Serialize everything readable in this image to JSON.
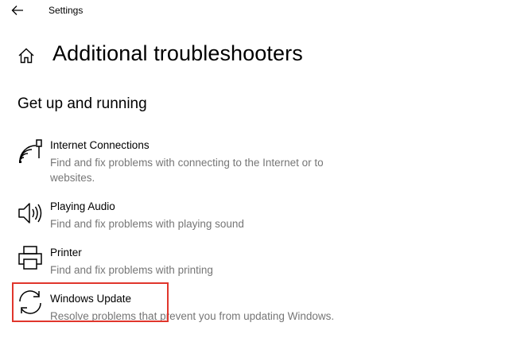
{
  "window": {
    "app_title": "Settings",
    "back_icon": "back-arrow-icon",
    "home_icon": "home-icon"
  },
  "page": {
    "title": "Additional troubleshooters"
  },
  "section": {
    "title": "Get up and running",
    "items": [
      {
        "icon": "internet-connections-icon",
        "name": "Internet Connections",
        "description": "Find and fix problems with connecting to the Internet or to websites."
      },
      {
        "icon": "speaker-icon",
        "name": "Playing Audio",
        "description": "Find and fix problems with playing sound"
      },
      {
        "icon": "printer-icon",
        "name": "Printer",
        "description": "Find and fix problems with printing"
      },
      {
        "icon": "refresh-icon",
        "name": "Windows Update",
        "description": "Resolve problems that prevent you from updating Windows."
      }
    ]
  },
  "colors": {
    "highlight_border": "#e0362c",
    "description_text": "#767676"
  }
}
